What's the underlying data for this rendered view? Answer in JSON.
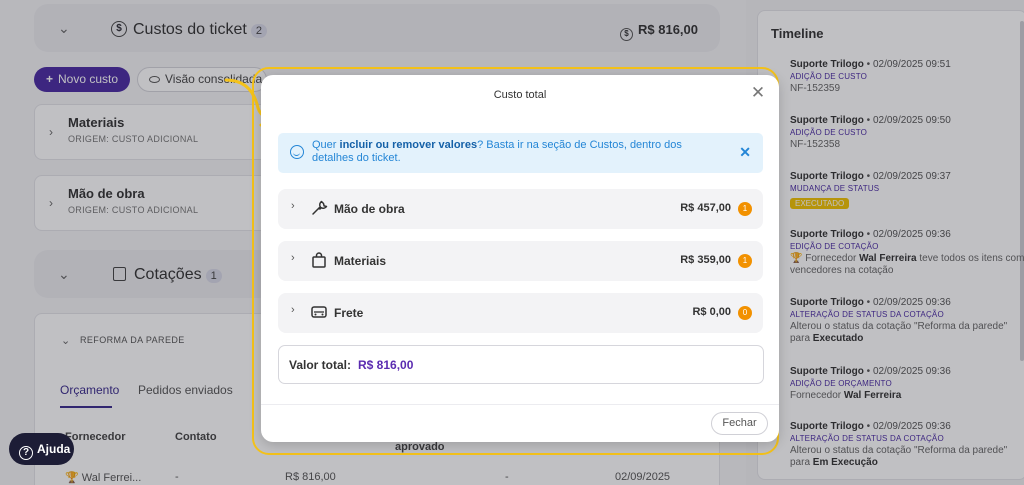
{
  "costs_section": {
    "title": "Custos do ticket",
    "count": "2",
    "total": "R$ 816,00",
    "new_cost_label": "Novo custo",
    "view_label": "Visão consolidada",
    "items": [
      {
        "name": "Materiais",
        "origin": "ORIGEM: CUSTO ADICIONAL"
      },
      {
        "name": "Mão de obra",
        "origin": "ORIGEM: CUSTO ADICIONAL"
      }
    ]
  },
  "quotes_section": {
    "title": "Cotações",
    "count": "1",
    "quote_name": "REFORMA DA PAREDE",
    "tabs": [
      "Orçamento",
      "Pedidos enviados"
    ],
    "columns": [
      "Fornecedor",
      "Contato",
      "aprovado"
    ],
    "row": {
      "supplier": "Wal Ferrei...",
      "contact": "-",
      "value": "R$ 816,00",
      "dash": "-",
      "date": "02/09/2025"
    }
  },
  "help": {
    "label": "Ajuda"
  },
  "timeline": {
    "title": "Timeline",
    "entries": [
      {
        "author": "Suporte Trilogo",
        "date": "02/09/2025 09:51",
        "action": "ADIÇÃO DE CUSTO",
        "detail": "NF-152359"
      },
      {
        "author": "Suporte Trilogo",
        "date": "02/09/2025 09:50",
        "action": "ADIÇÃO DE CUSTO",
        "detail": "NF-152358"
      },
      {
        "author": "Suporte Trilogo",
        "date": "02/09/2025 09:37",
        "action": "MUDANÇA DE STATUS",
        "tag": "EXECUTADO"
      },
      {
        "author": "Suporte Trilogo",
        "date": "02/09/2025 09:36",
        "action": "EDIÇÃO DE COTAÇÃO",
        "detail_pre": "Fornecedor",
        "detail_bold": "Wal Ferreira",
        "detail_post": "teve todos os itens como vencedores na cotação"
      },
      {
        "author": "Suporte Trilogo",
        "date": "02/09/2025 09:36",
        "action": "ALTERAÇÃO DE STATUS DA COTAÇÃO",
        "detail_pre": "Alterou o status da cotação \"Reforma da parede\" para",
        "detail_bold": "Executado"
      },
      {
        "author": "Suporte Trilogo",
        "date": "02/09/2025 09:36",
        "action": "ADIÇÃO DE ORÇAMENTO",
        "detail_pre": "Fornecedor",
        "detail_bold": "Wal Ferreira"
      },
      {
        "author": "Suporte Trilogo",
        "date": "02/09/2025 09:36",
        "action": "ALTERAÇÃO DE STATUS DA COTAÇÃO",
        "detail_pre": "Alterou o status da cotação \"Reforma da parede\" para",
        "detail_bold": "Em Execução"
      }
    ]
  },
  "modal": {
    "title": "Custo total",
    "info": {
      "pre": "Quer ",
      "bold": "incluir ou remover valores",
      "post": "? Basta ir na seção de Custos, dentro dos detalhes do ticket."
    },
    "rows": [
      {
        "name": "Mão de obra",
        "amount": "R$ 457,00",
        "count": "1",
        "icon": "wrench-icon"
      },
      {
        "name": "Materiais",
        "amount": "R$ 359,00",
        "count": "1",
        "icon": "shopping-bag-icon"
      },
      {
        "name": "Frete",
        "amount": "R$ 0,00",
        "count": "0",
        "icon": "truck-icon"
      }
    ],
    "total_label": "Valor total:",
    "total_value": "R$ 816,00",
    "close_label": "Fechar"
  },
  "colors": {
    "accent": "#4a2aa3",
    "highlight_frame": "#f4c21a",
    "info_bg": "#e3f2fc",
    "count_badge": "#f29100"
  }
}
